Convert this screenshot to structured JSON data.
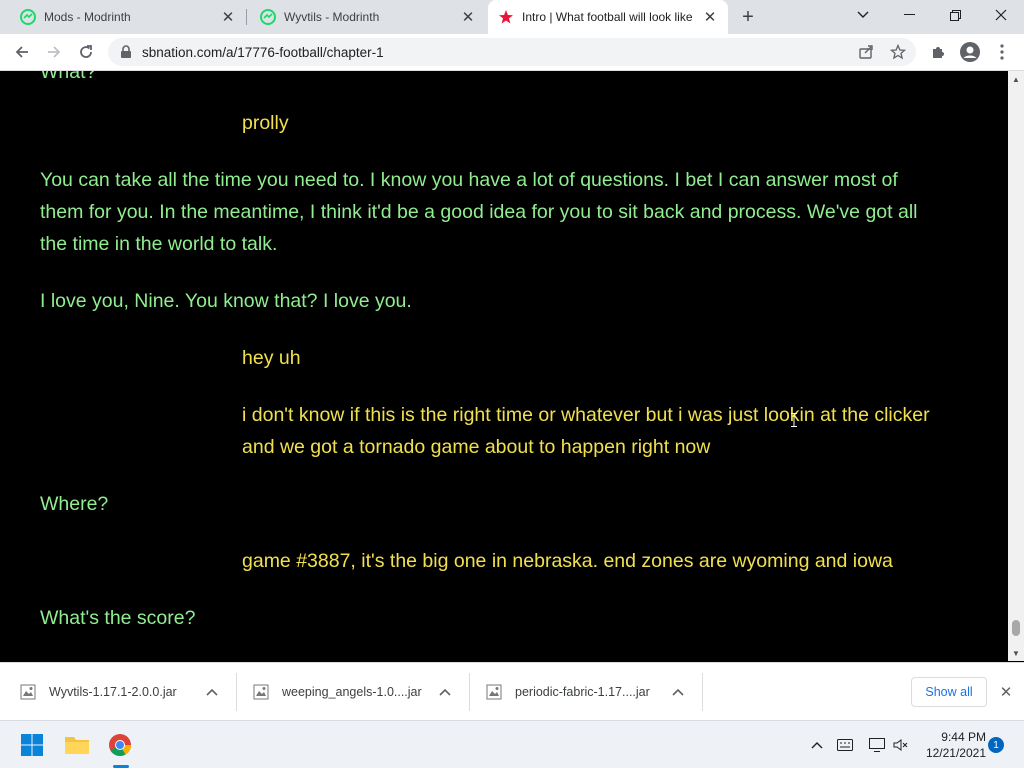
{
  "tabs": [
    {
      "title": "Mods - Modrinth",
      "icon": "modrinth-icon",
      "active": false
    },
    {
      "title": "Wyvtils - Modrinth",
      "icon": "modrinth-icon",
      "active": false
    },
    {
      "title": "Intro | What football will look like",
      "icon": "sbnation-star-icon",
      "active": true
    }
  ],
  "address_bar": {
    "url": "sbnation.com/a/17776-football/chapter-1"
  },
  "content": {
    "cut_off_line": "What?",
    "messages": [
      {
        "speaker": "yellow",
        "text": "prolly"
      },
      {
        "speaker": "green",
        "lines": [
          "You can take all the time you need to. I know you have a lot of questions. I bet I can answer most of",
          "them for you. In the meantime, I think it'd be a good idea for you to sit back and process. We've got all",
          "the time in the world to talk."
        ]
      },
      {
        "speaker": "green",
        "text": "I love you, Nine. You know that? I love you."
      },
      {
        "speaker": "yellow",
        "text": "hey uh"
      },
      {
        "speaker": "yellow",
        "lines": [
          "i don't know if this is the right time or whatever but i was just lookin at the clicker",
          "and we got a tornado game about to happen right now"
        ]
      },
      {
        "speaker": "green",
        "text": "Where?"
      },
      {
        "speaker": "yellow",
        "text": "game #3887, it's the big one in nebraska. end zones are wyoming and iowa"
      },
      {
        "speaker": "green",
        "text": "What's the score?"
      }
    ]
  },
  "downloads": [
    {
      "name": "Wyvtils-1.17.1-2.0.0.jar"
    },
    {
      "name": "weeping_angels-1.0....jar"
    },
    {
      "name": "periodic-fabric-1.17....jar"
    }
  ],
  "download_bar": {
    "show_all": "Show all"
  },
  "taskbar": {
    "time": "9:44 PM",
    "date": "12/21/2021",
    "notification_count": "1"
  },
  "colors": {
    "green_text": "#90ee90",
    "yellow_text": "#f0e050",
    "background": "#000000",
    "accent": "#1a73e8"
  }
}
